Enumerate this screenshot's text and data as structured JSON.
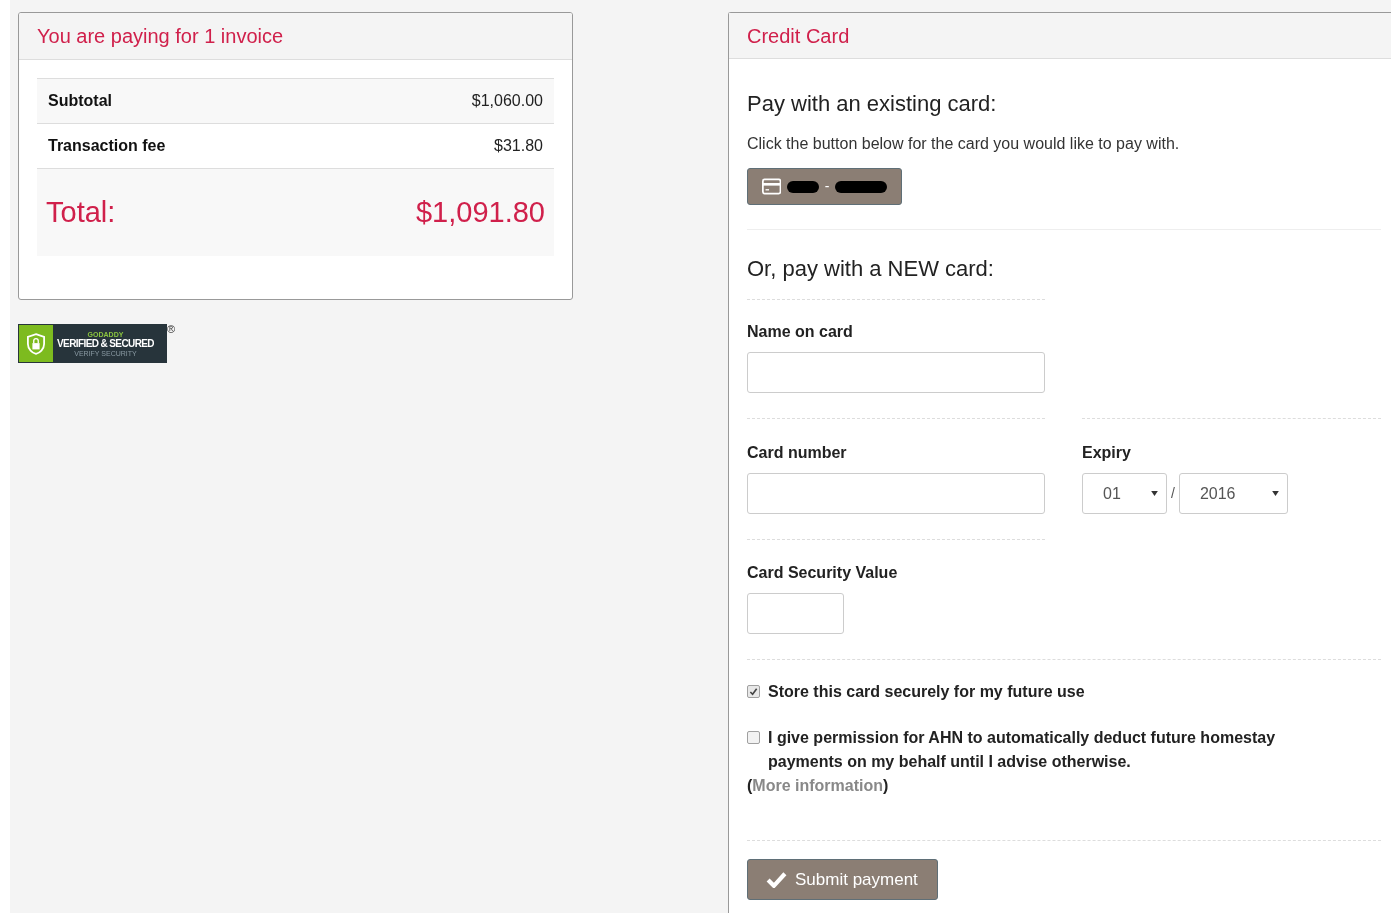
{
  "summary": {
    "title": "You are paying for 1 invoice",
    "rows": [
      {
        "label": "Subtotal",
        "value": "$1,060.00"
      },
      {
        "label": "Transaction fee",
        "value": "$31.80"
      }
    ],
    "total": {
      "label": "Total:",
      "value": "$1,091.80"
    }
  },
  "seal": {
    "brand": "GODADDY",
    "headline": "VERIFIED & SECURED",
    "subline": "VERIFY SECURITY",
    "registered": "®"
  },
  "credit_card": {
    "title": "Credit Card",
    "existing": {
      "heading": "Pay with an existing card:",
      "hint": "Click the button below for the card you would like to pay with.",
      "card_separator": "-"
    },
    "new_card": {
      "heading": "Or, pay with a NEW card:",
      "name_label": "Name on card",
      "number_label": "Card number",
      "expiry_label": "Expiry",
      "expiry_month": "01",
      "expiry_separator": "/",
      "expiry_year": "2016",
      "cvv_label": "Card Security Value"
    },
    "options": [
      {
        "label": "Store this card securely for my future use",
        "checked": true
      },
      {
        "label": "I give permission for AHN to automatically deduct future homestay payments on my behalf until I advise otherwise.",
        "checked": false,
        "link_open": "(",
        "link": "More information",
        "link_close": ")"
      }
    ],
    "submit": "Submit payment"
  }
}
